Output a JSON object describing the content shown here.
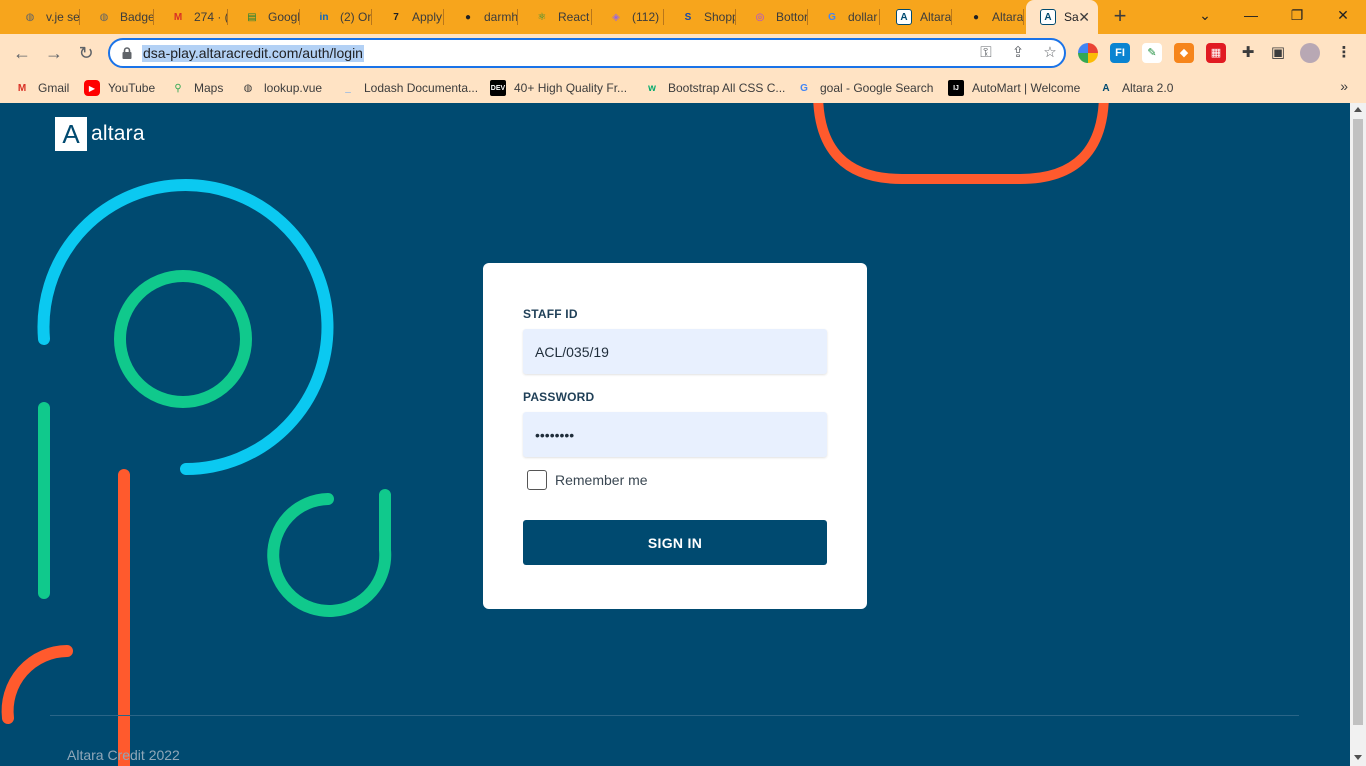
{
  "browser": {
    "tabs": [
      {
        "label": "v.je se",
        "favicon": "globe-icon",
        "color": "#5f6368"
      },
      {
        "label": "Badge",
        "favicon": "globe-icon",
        "color": "#5f6368"
      },
      {
        "label": "274 · (",
        "favicon": "gmail-icon",
        "color": "#d93025"
      },
      {
        "label": "Googl",
        "favicon": "google-sheets-icon",
        "color": "#188038"
      },
      {
        "label": "(2) On",
        "favicon": "linkedin-icon",
        "color": "#0a66c2"
      },
      {
        "label": "Apply",
        "favicon": "seven-icon",
        "color": "#202124"
      },
      {
        "label": "darmh",
        "favicon": "github-icon",
        "color": "#202124"
      },
      {
        "label": "React",
        "favicon": "react-icon",
        "color": "#1e8e3e"
      },
      {
        "label": "(112)",
        "favicon": "extension-icon",
        "color": "#9c6ade"
      },
      {
        "label": "Shopp",
        "favicon": "shop-icon",
        "color": "#1a4aa8"
      },
      {
        "label": "Bottor",
        "favicon": "circle-icon",
        "color": "#a142f4"
      },
      {
        "label": "dollar",
        "favicon": "google-icon",
        "color": "#4285f4"
      },
      {
        "label": "Altara",
        "favicon": "altara-icon",
        "color": "#004a70"
      },
      {
        "label": "Altara",
        "favicon": "github-icon",
        "color": "#202124"
      },
      {
        "label": "Sa",
        "favicon": "altara-icon",
        "color": "#004a70"
      }
    ],
    "address": {
      "url": "dsa-play.altaracredit.com/auth/login"
    },
    "bookmarks": [
      {
        "label": "Gmail",
        "favicon": "gmail-icon",
        "color": "#d93025"
      },
      {
        "label": "YouTube",
        "favicon": "youtube-icon",
        "color": "#ff0000"
      },
      {
        "label": "Maps",
        "favicon": "maps-icon",
        "color": "#34a853"
      },
      {
        "label": "lookup.vue",
        "favicon": "globe-icon",
        "color": "#3c3c3c"
      },
      {
        "label": "Lodash Documenta...",
        "favicon": "lodash-icon",
        "color": "#3492ff"
      },
      {
        "label": "40+ High Quality Fr...",
        "favicon": "dev-icon",
        "color": "#000000"
      },
      {
        "label": "Bootstrap All CSS C...",
        "favicon": "w3-icon",
        "color": "#04aa6d"
      },
      {
        "label": "goal - Google Search",
        "favicon": "google-icon",
        "color": "#4285f4"
      },
      {
        "label": "AutoMart | Welcome",
        "favicon": "ij-icon",
        "color": "#000000"
      },
      {
        "label": "Altara 2.0",
        "favicon": "altara-icon",
        "color": "#004a70"
      }
    ]
  },
  "page": {
    "logo": {
      "mark": "A",
      "text": "altara"
    },
    "form": {
      "staff_id_label": "STAFF ID",
      "staff_id_value": "ACL/035/19",
      "password_label": "PASSWORD",
      "password_value": "••••••••",
      "remember_label": "Remember me",
      "submit_label": "SIGN IN"
    },
    "footer": "Altara Credit 2022"
  },
  "colors": {
    "background": "#004a70",
    "cyan": "#0bc9f1",
    "green": "#10c98c",
    "orange": "#ff5a2d",
    "tab_strip": "#f7a51c",
    "toolbar": "#ffe3c4"
  }
}
